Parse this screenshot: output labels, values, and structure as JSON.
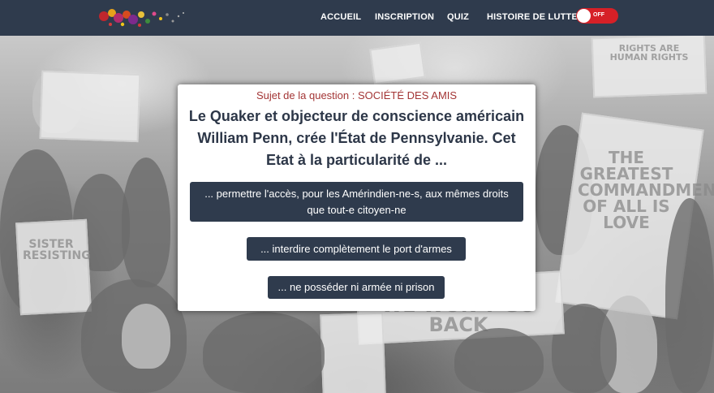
{
  "nav": {
    "logo_alt": "logo",
    "links": [
      {
        "label": "ACCUEIL"
      },
      {
        "label": "INSCRIPTION"
      },
      {
        "label": "QUIZ"
      },
      {
        "label": "HISTOIRE DE LUTTE"
      }
    ],
    "toggle": {
      "state_label": "OFF"
    }
  },
  "quiz": {
    "subject_prefix": "Sujet de la question : SOCIÉTÉ DES AMIS",
    "question": "Le Quaker et objecteur de conscience américain William Penn, crée l'État de Pennsylvanie. Cet Etat à la particularité de ...",
    "answers": [
      {
        "label": "... permettre l'accès, pour les Amérindien-ne-s, aux mêmes droits que tout-e citoyen-ne"
      },
      {
        "label": "... interdire complètement le port d'armes"
      },
      {
        "label": "... ne posséder ni armée ni prison"
      }
    ]
  },
  "background_signs": {
    "sign_right_top": "RIGHTS ARE HUMAN RIGHTS",
    "sign_right_mid": "THE GREATEST COMMANDMENT OF ALL IS LOVE",
    "sign_left": "SISTER RESISTING",
    "sign_bottom_mid": "WE WON'T GO BACK"
  },
  "colors": {
    "navbar": "#2f3b4d",
    "subject_text": "#a33535",
    "question_text": "#2d3748",
    "answer_button": "#2f3b4d",
    "toggle_off": "#d62027"
  }
}
